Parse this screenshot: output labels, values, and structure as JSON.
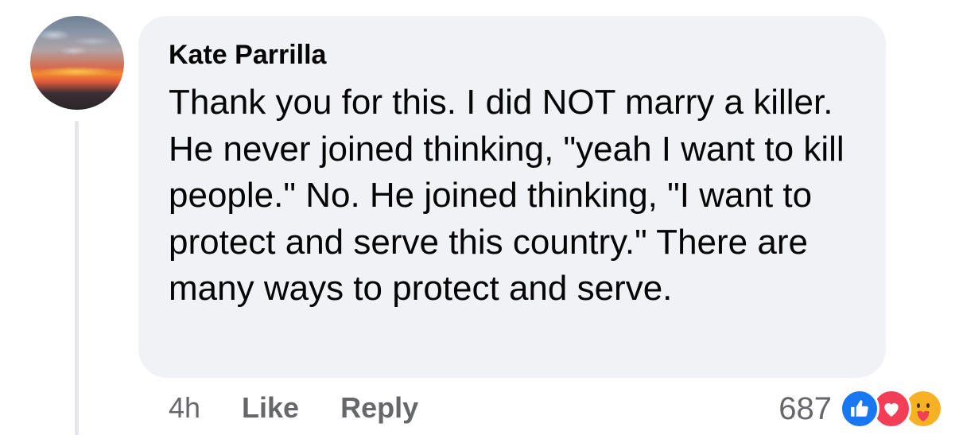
{
  "comment": {
    "author": "Kate Parrilla",
    "text": "Thank you for this. I did NOT marry a killer. He never joined thinking, \"yeah I want to kill people.\" No. He joined thinking, \"I want to protect and serve this country.\" There are many ways to protect and serve.",
    "time": "4h",
    "like_label": "Like",
    "reply_label": "Reply",
    "reaction_count": "687",
    "reactions": [
      "like-icon",
      "love-icon",
      "care-icon"
    ]
  },
  "colors": {
    "bubble": "#f0f2f5",
    "text": "#050505",
    "meta": "#65676b",
    "like": "#1877f2",
    "love": "#f33e58",
    "care": "#f7b125"
  }
}
